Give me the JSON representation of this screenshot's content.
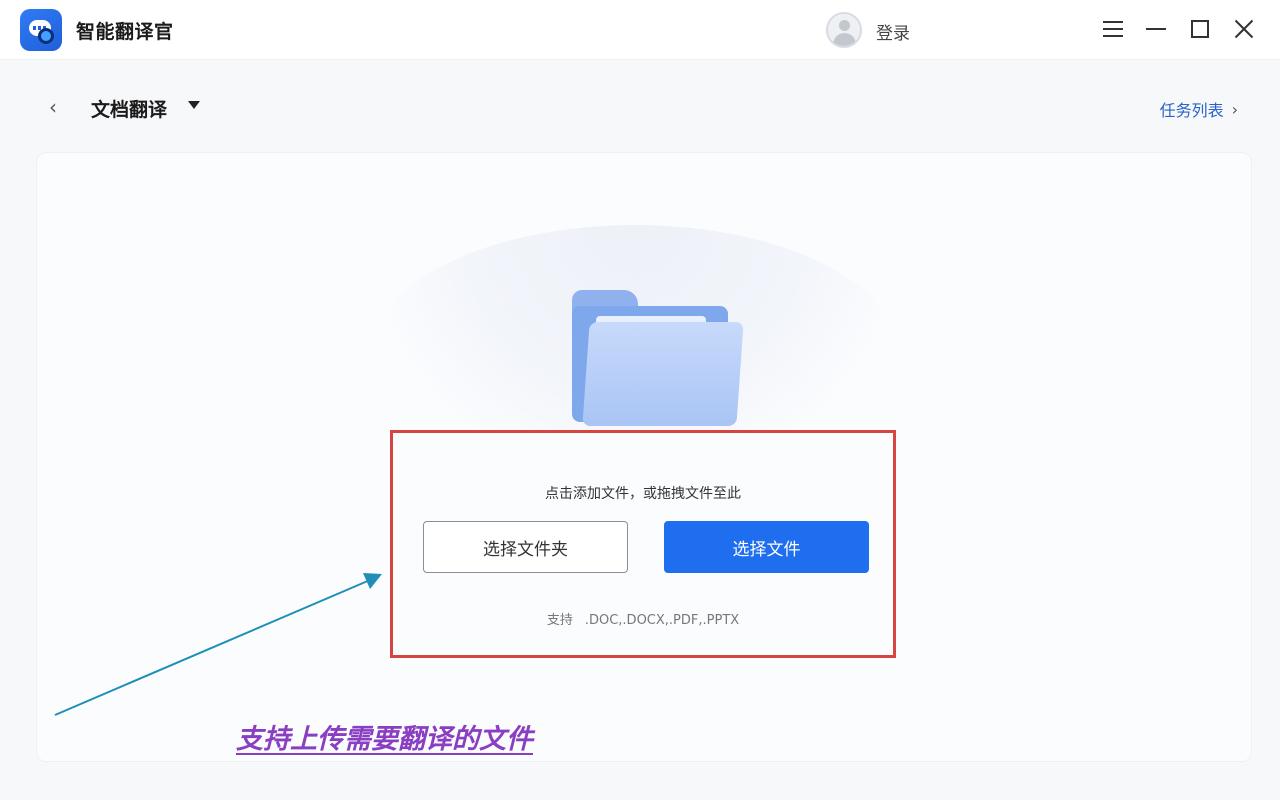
{
  "app": {
    "title": "智能翻译官",
    "login_label": "登录"
  },
  "window_controls": {
    "menu_icon": "menu-icon",
    "minimize_icon": "minimize-icon",
    "maximize_icon": "maximize-icon",
    "close_icon": "close-icon"
  },
  "header": {
    "back_icon": "chevron-left-icon",
    "mode_title": "文档翻译",
    "mode_caret_icon": "caret-down-icon",
    "task_list_label": "任务列表",
    "task_list_icon": "chevron-right-icon"
  },
  "upload": {
    "hint": "点击添加文件，或拖拽文件至此",
    "select_folder_label": "选择文件夹",
    "select_file_label": "选择文件",
    "formats_label": "支持",
    "formats_value": ".DOC,.DOCX,.PDF,.PPTX"
  },
  "annotation": {
    "caption": "支持上传需要翻译的文件",
    "arrow_color": "#1f8fb8",
    "caption_color": "#8a3ec2",
    "highlight_color": "#d8443f"
  },
  "colors": {
    "primary": "#1f6ef0",
    "link": "#2a62c9"
  }
}
